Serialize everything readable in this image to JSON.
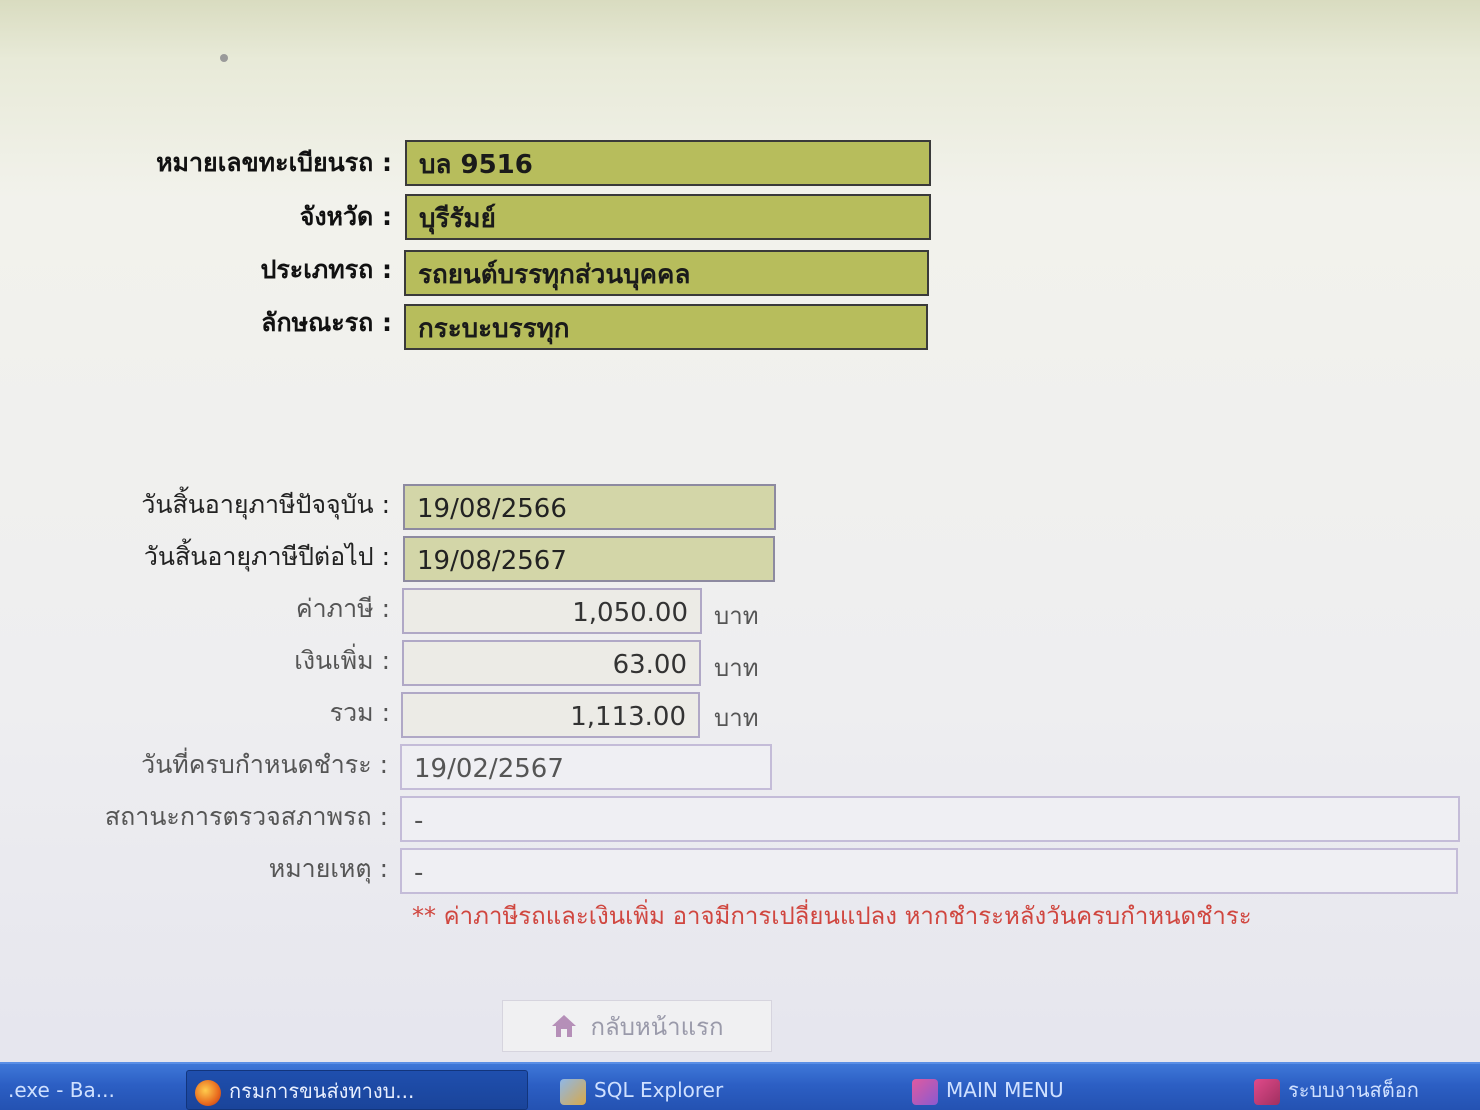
{
  "vehicle": {
    "plate_label": "หมายเลขทะเบียนรถ :",
    "plate_value": "บล 9516",
    "province_label": "จังหวัด :",
    "province_value": "บุรีรัมย์",
    "type_label": "ประเภทรถ :",
    "type_value": "รถยนต์บรรทุกส่วนบุคคล",
    "style_label": "ลักษณะรถ :",
    "style_value": "กระบะบรรทุก"
  },
  "tax": {
    "current_expiry_label": "วันสิ้นอายุภาษีปัจจุบัน :",
    "current_expiry_value": "19/08/2566",
    "next_expiry_label": "วันสิ้นอายุภาษีปีต่อไป :",
    "next_expiry_value": "19/08/2567",
    "tax_label": "ค่าภาษี :",
    "tax_value": "1,050.00",
    "surcharge_label": "เงินเพิ่ม :",
    "surcharge_value": "63.00",
    "total_label": "รวม :",
    "total_value": "1,113.00",
    "unit": "บาท",
    "due_label": "วันที่ครบกำหนดชำระ :",
    "due_value": "19/02/2567",
    "inspection_label": "สถานะการตรวจสภาพรถ :",
    "inspection_value": "-",
    "remark_label": "หมายเหตุ :",
    "remark_value": "-"
  },
  "note": "** ค่าภาษีรถและเงินเพิ่ม อาจมีการเปลี่ยนแปลง หากชำระหลังวันครบกำหนดชำระ",
  "home_button": "กลับหน้าแรก",
  "taskbar": {
    "items": [
      ".exe - Ba...",
      "กรมการขนส่งทางบ...",
      "SQL Explorer",
      "MAIN MENU",
      "ระบบงานสต็อก"
    ]
  }
}
